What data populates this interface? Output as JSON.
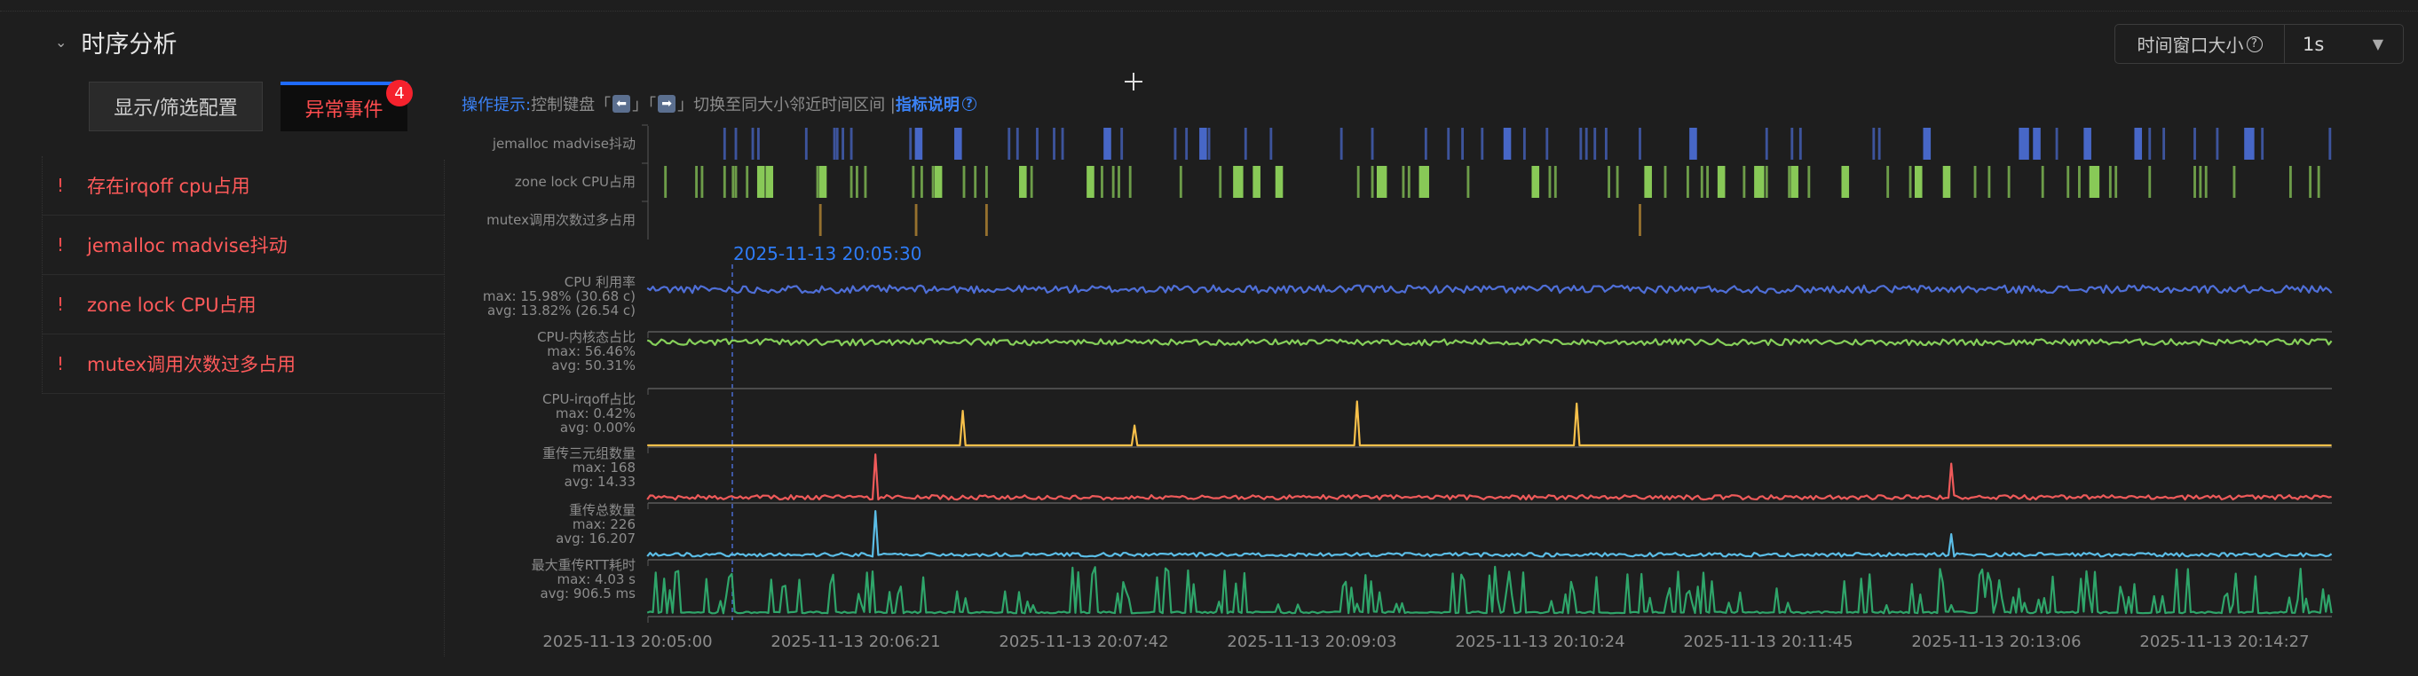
{
  "section": {
    "title": "时序分析"
  },
  "buttons": {
    "display_filter": "显示/筛选配置",
    "anomaly_events": "异常事件",
    "anomaly_count": "4"
  },
  "anomalies": [
    {
      "label": "存在irqoff cpu占用"
    },
    {
      "label": "jemalloc madvise抖动"
    },
    {
      "label": "zone lock CPU占用"
    },
    {
      "label": "mutex调用次数过多占用"
    }
  ],
  "hint": {
    "prefix": "操作提示:",
    "text1": "控制键盘「",
    "left_key": "⬅",
    "mid": "」「",
    "right_key": "➡",
    "text2": "」切换至同大小邻近时间区间 | ",
    "link": "指标说明",
    "help_icon": "?"
  },
  "time_window": {
    "label": "时间窗口大小",
    "help_icon": "?",
    "value": "1s"
  },
  "hover_time": "2025-11-13 20:05:30",
  "colors": {
    "jemalloc": "#4a6bd1",
    "zone": "#8ed35b",
    "mutex": "#c99434",
    "cpu": "#4f6fd8",
    "kernel": "#86d05a",
    "irqoff": "#f7c04a",
    "retrans_tuple": "#ef5a5a",
    "retrans_total": "#5bbde6",
    "rtt": "#2fa56a"
  },
  "chart_data": {
    "type": "line",
    "x_unit": "seconds since 2025-11-13 20:05:00",
    "x_range": [
      7,
      605
    ],
    "x_ticks": [
      {
        "t": 0,
        "label": "2025-11-13 20:05:00"
      },
      {
        "t": 81,
        "label": "2025-11-13 20:06:21"
      },
      {
        "t": 162,
        "label": "2025-11-13 20:07:42"
      },
      {
        "t": 243,
        "label": "2025-11-13 20:09:03"
      },
      {
        "t": 324,
        "label": "2025-11-13 20:10:24"
      },
      {
        "t": 405,
        "label": "2025-11-13 20:11:45"
      },
      {
        "t": 486,
        "label": "2025-11-13 20:13:06"
      },
      {
        "t": 567,
        "label": "2025-11-13 20:14:27"
      }
    ],
    "event_lanes": [
      {
        "name": "jemalloc madvise抖动",
        "color_key": "jemalloc",
        "events": [
          [
            34,
            1
          ],
          [
            38,
            1
          ],
          [
            44,
            1
          ],
          [
            46,
            1
          ],
          [
            63,
            1
          ],
          [
            73,
            1
          ],
          [
            74,
            1
          ],
          [
            76,
            1
          ],
          [
            79,
            1
          ],
          [
            100,
            1
          ],
          [
            102,
            3
          ],
          [
            116,
            3
          ],
          [
            135,
            1
          ],
          [
            138,
            1
          ],
          [
            145,
            1
          ],
          [
            151,
            1
          ],
          [
            154,
            1
          ],
          [
            169,
            3
          ],
          [
            175,
            1
          ],
          [
            194,
            1
          ],
          [
            198,
            1
          ],
          [
            203,
            3
          ],
          [
            206,
            1
          ],
          [
            219,
            1
          ],
          [
            228,
            1
          ],
          [
            253,
            1
          ],
          [
            264,
            1
          ],
          [
            283,
            1
          ],
          [
            291,
            1
          ],
          [
            296,
            1
          ],
          [
            303,
            1
          ],
          [
            311,
            3
          ],
          [
            318,
            1
          ],
          [
            326,
            1
          ],
          [
            338,
            1
          ],
          [
            340,
            1
          ],
          [
            343,
            1
          ],
          [
            347,
            1
          ],
          [
            359,
            1
          ],
          [
            377,
            3
          ],
          [
            404,
            1
          ],
          [
            413,
            1
          ],
          [
            416,
            1
          ],
          [
            442,
            1
          ],
          [
            444,
            1
          ],
          [
            460,
            3
          ],
          [
            494,
            4
          ],
          [
            499,
            3
          ],
          [
            507,
            1
          ],
          [
            517,
            3
          ],
          [
            535,
            3
          ],
          [
            540,
            1
          ],
          [
            545,
            1
          ],
          [
            556,
            1
          ],
          [
            564,
            1
          ],
          [
            574,
            4
          ],
          [
            580,
            1
          ],
          [
            604,
            1
          ]
        ]
      },
      {
        "name": "zone lock CPU占用",
        "color_key": "zone",
        "events": [
          [
            13,
            1
          ],
          [
            24,
            1
          ],
          [
            26,
            1
          ],
          [
            34,
            1
          ],
          [
            37,
            1
          ],
          [
            38,
            1
          ],
          [
            42,
            1
          ],
          [
            46,
            3
          ],
          [
            49,
            3
          ],
          [
            67,
            1
          ],
          [
            68,
            3
          ],
          [
            79,
            1
          ],
          [
            81,
            1
          ],
          [
            84,
            1
          ],
          [
            101,
            1
          ],
          [
            104,
            1
          ],
          [
            108,
            1
          ],
          [
            109,
            3
          ],
          [
            119,
            1
          ],
          [
            123,
            1
          ],
          [
            127,
            1
          ],
          [
            139,
            3
          ],
          [
            143,
            1
          ],
          [
            163,
            3
          ],
          [
            168,
            1
          ],
          [
            172,
            1
          ],
          [
            174,
            1
          ],
          [
            178,
            1
          ],
          [
            196,
            1
          ],
          [
            210,
            1
          ],
          [
            215,
            4
          ],
          [
            222,
            3
          ],
          [
            230,
            3
          ],
          [
            259,
            1
          ],
          [
            264,
            1
          ],
          [
            266,
            4
          ],
          [
            275,
            1
          ],
          [
            277,
            1
          ],
          [
            281,
            4
          ],
          [
            298,
            1
          ],
          [
            321,
            3
          ],
          [
            327,
            1
          ],
          [
            329,
            1
          ],
          [
            348,
            1
          ],
          [
            351,
            1
          ],
          [
            361,
            3
          ],
          [
            368,
            1
          ],
          [
            376,
            1
          ],
          [
            381,
            1
          ],
          [
            383,
            1
          ],
          [
            387,
            3
          ],
          [
            396,
            1
          ],
          [
            400,
            4
          ],
          [
            404,
            1
          ],
          [
            412,
            1
          ],
          [
            413,
            3
          ],
          [
            419,
            1
          ],
          [
            431,
            3
          ],
          [
            447,
            1
          ],
          [
            455,
            1
          ],
          [
            457,
            3
          ],
          [
            467,
            3
          ],
          [
            478,
            1
          ],
          [
            483,
            1
          ],
          [
            490,
            1
          ],
          [
            502,
            1
          ],
          [
            511,
            1
          ],
          [
            515,
            1
          ],
          [
            519,
            4
          ],
          [
            526,
            1
          ],
          [
            528,
            1
          ],
          [
            540,
            1
          ],
          [
            556,
            1
          ],
          [
            558,
            1
          ],
          [
            560,
            1
          ],
          [
            570,
            1
          ],
          [
            590,
            1
          ],
          [
            597,
            1
          ],
          [
            600,
            1
          ]
        ]
      },
      {
        "name": "mutex调用次数过多占用",
        "color_key": "mutex",
        "events": [
          [
            68,
            1
          ],
          [
            102,
            1
          ],
          [
            127,
            1
          ],
          [
            359,
            1
          ]
        ]
      }
    ],
    "series": [
      {
        "name": "CPU 利用率",
        "max_text": "max: 15.98% (30.68 c)",
        "avg_text": "avg: 13.82% (26.54 c)",
        "color_key": "cpu",
        "ylim": [
          0,
          16.5
        ],
        "base": 13.8,
        "noise": 1.3,
        "spikes": [],
        "seed": 11
      },
      {
        "name": "CPU-内核态占比",
        "max_text": "max: 56.46%",
        "avg_text": "avg: 50.31%",
        "color_key": "kernel",
        "ylim": [
          0,
          57
        ],
        "base": 50.3,
        "noise": 3.5,
        "spikes": [],
        "seed": 23
      },
      {
        "name": "CPU-irqoff占比",
        "max_text": "max: 0.42%",
        "avg_text": "avg: 0.00%",
        "color_key": "irqoff",
        "ylim": [
          0,
          0.45
        ],
        "base": 0,
        "noise": 0,
        "spikes": [
          [
            119,
            0.33
          ],
          [
            180,
            0.19
          ],
          [
            259,
            0.42
          ],
          [
            337,
            0.4
          ]
        ],
        "seed": 3
      },
      {
        "name": "重传三元组数量",
        "max_text": "max: 168",
        "avg_text": "avg: 14.33",
        "color_key": "retrans_tuple",
        "ylim": [
          0,
          175
        ],
        "base": 14,
        "noise": 8,
        "spikes": [
          [
            88,
            168
          ],
          [
            470,
            135
          ]
        ],
        "seed": 37
      },
      {
        "name": "重传总数量",
        "max_text": "max: 226",
        "avg_text": "avg: 16.207",
        "color_key": "retrans_total",
        "ylim": [
          0,
          235
        ],
        "base": 16,
        "noise": 9,
        "spikes": [
          [
            88,
            226
          ],
          [
            470,
            115
          ]
        ],
        "seed": 41
      },
      {
        "name": "最大重传RTT耗时",
        "max_text": "max: 4.03 s",
        "avg_text": "avg: 906.5 ms",
        "color_key": "rtt",
        "ylim": [
          0,
          4.2
        ],
        "base": 0.2,
        "noise": 0.15,
        "spikes": [],
        "bursty": true,
        "seed": 57
      }
    ]
  }
}
